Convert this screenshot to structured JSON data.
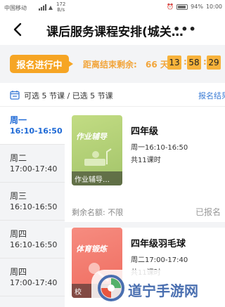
{
  "status_bar": {
    "carrier": "中国移动",
    "speed_value": "172",
    "speed_unit": "B/s",
    "battery": "94%",
    "time": "10:00"
  },
  "header": {
    "title": "课后服务课程安排(城关…",
    "more": "•••"
  },
  "countdown": {
    "badge": "报名进行中",
    "label": "距离结束剩余:",
    "days": "66 天",
    "hours": "13",
    "minutes": "58",
    "seconds": "29"
  },
  "summary": {
    "text": "可选 5 节课 / 已选 5 节课",
    "link": "报名结果"
  },
  "days": [
    {
      "name": "周一",
      "time": "16:10-16:50",
      "active": true
    },
    {
      "name": "周二",
      "time": "17:00-17:40",
      "active": false
    },
    {
      "name": "周三",
      "time": "16:10-16:50",
      "active": false
    },
    {
      "name": "周四",
      "time": "16:10-16:50",
      "active": false
    },
    {
      "name": "周四",
      "time": "17:00-17:40",
      "active": false
    }
  ],
  "courses": [
    {
      "category": "作业辅导",
      "caption": "作业辅导…",
      "name": "四年级",
      "time": "周一16:10-16:50",
      "hours": "共11课时",
      "quota": "剩余名额:  不限",
      "status": "已报名",
      "color": "#b4d276"
    },
    {
      "category": "体育锻炼",
      "caption": "校",
      "name": "四年级羽毛球",
      "time": "周二17:00-17:40",
      "hours": "共11课时",
      "color": "#f27a6d"
    }
  ],
  "watermark": {
    "text": "道宁手游网"
  }
}
